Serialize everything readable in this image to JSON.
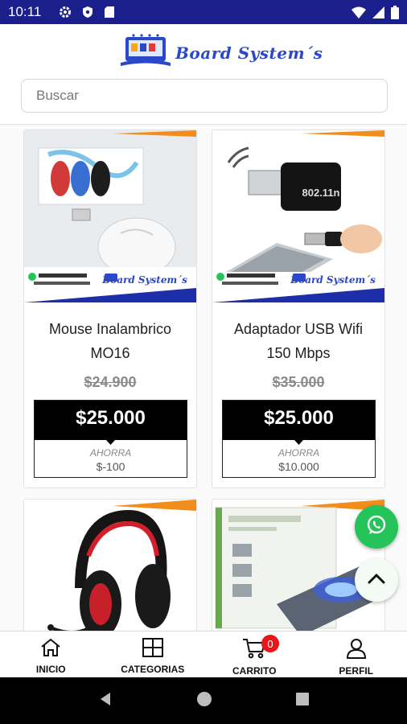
{
  "status_bar": {
    "time": "10:11"
  },
  "header": {
    "brand_name": "Board System´s",
    "search": {
      "placeholder": "Buscar",
      "value": ""
    }
  },
  "products": [
    {
      "title_line1": "Mouse Inalambrico",
      "title_line2": "MO16",
      "old_price": "$24.900",
      "price": "$25.000",
      "saves_label": "AHORRA",
      "saves_value": "$-100"
    },
    {
      "title_line1": "Adaptador USB Wifi",
      "title_line2": "150 Mbps",
      "old_price": "$35.000",
      "price": "$25.000",
      "saves_label": "AHORRA",
      "saves_value": "$10.000"
    },
    {
      "title_line1": "",
      "title_line2": ""
    },
    {
      "title_line1": "",
      "title_line2": ""
    }
  ],
  "bottom_nav": {
    "items": [
      {
        "label": "INICIO",
        "icon": "home-icon"
      },
      {
        "label": "CATEGORIAS",
        "icon": "grid-icon"
      },
      {
        "label": "CARRITO",
        "icon": "cart-icon",
        "badge": "0"
      },
      {
        "label": "PERFIL",
        "icon": "user-icon"
      }
    ]
  },
  "colors": {
    "status_bar": "#1a1f8c",
    "brand_blue": "#2b48c8",
    "whatsapp": "#25c45a",
    "badge_red": "#e8151b",
    "price_bg": "#000000"
  }
}
